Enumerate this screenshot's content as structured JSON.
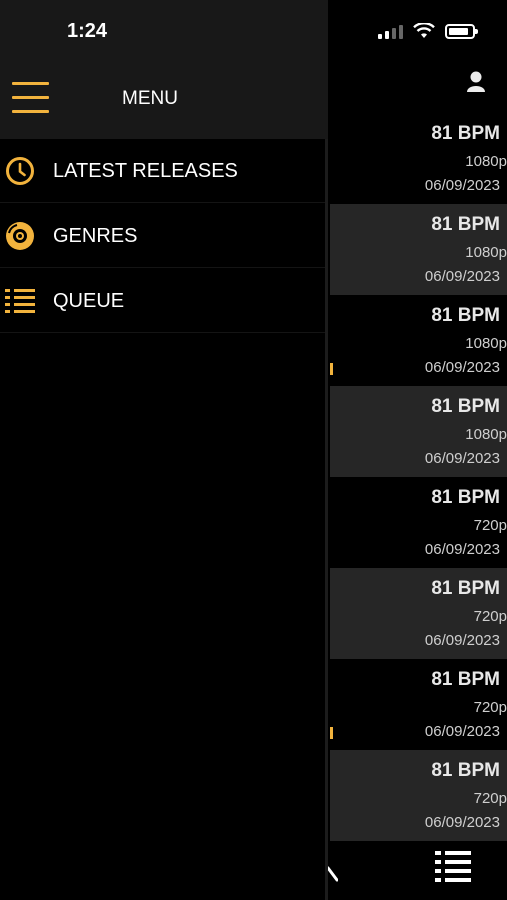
{
  "status": {
    "time": "1:24"
  },
  "drawer": {
    "title": "MENU",
    "items": [
      {
        "label": "LATEST RELEASES",
        "icon": "clock-icon"
      },
      {
        "label": "GENRES",
        "icon": "disc-icon"
      },
      {
        "label": "QUEUE",
        "icon": "list-icon"
      }
    ]
  },
  "rows": [
    {
      "bpm": "81 BPM",
      "resolution": "1080p",
      "date": "06/09/2023"
    },
    {
      "bpm": "81 BPM",
      "resolution": "1080p",
      "date": "06/09/2023"
    },
    {
      "bpm": "81 BPM",
      "resolution": "1080p",
      "date": "06/09/2023"
    },
    {
      "bpm": "81 BPM",
      "resolution": "1080p",
      "date": "06/09/2023"
    },
    {
      "bpm": "81 BPM",
      "resolution": "720p",
      "date": "06/09/2023"
    },
    {
      "bpm": "81 BPM",
      "resolution": "720p",
      "date": "06/09/2023"
    },
    {
      "bpm": "81 BPM",
      "resolution": "720p",
      "date": "06/09/2023"
    },
    {
      "bpm": "81 BPM",
      "resolution": "720p",
      "date": "06/09/2023"
    }
  ],
  "colors": {
    "accent": "#f2b33d",
    "background": "#000000",
    "row_alt": "#262626",
    "drawer_header": "#181818"
  }
}
